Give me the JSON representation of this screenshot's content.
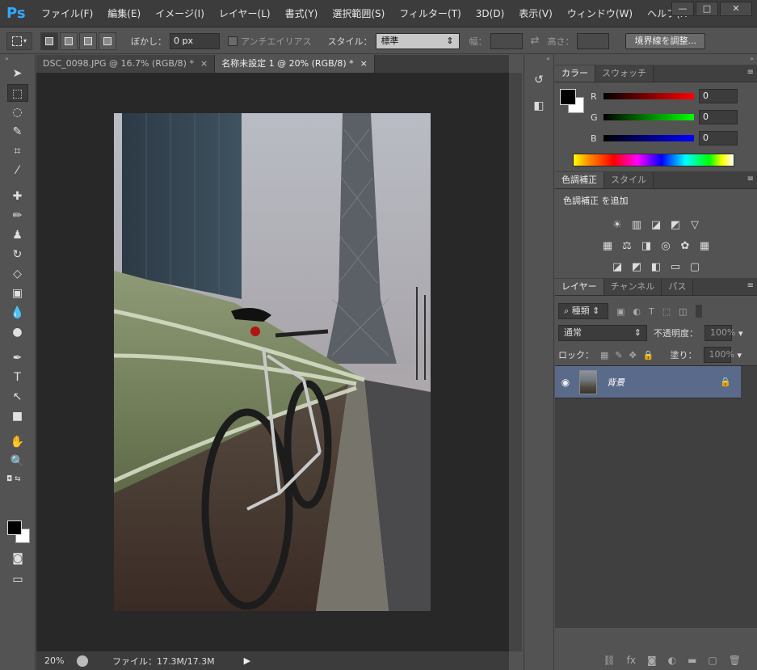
{
  "app": {
    "logo": "Ps",
    "menu": [
      "ファイル(F)",
      "編集(E)",
      "イメージ(I)",
      "レイヤー(L)",
      "書式(Y)",
      "選択範囲(S)",
      "フィルター(T)",
      "3D(D)",
      "表示(V)",
      "ウィンドウ(W)",
      "ヘルプ(H"
    ],
    "window_buttons": {
      "minimize": "—",
      "maximize": "□",
      "close": "✕"
    }
  },
  "options": {
    "feather_label": "ぼかし：",
    "feather_value": "0 px",
    "antialias_label": "アンチエイリアス",
    "style_label": "スタイル：",
    "style_value": "標準",
    "width_label": "幅：",
    "height_label": "高さ：",
    "refine_button": "境界線を調整..."
  },
  "documents": {
    "tabs": [
      {
        "title": "DSC_0098.JPG @ 16.7% (RGB/8) *",
        "close": "×",
        "active": false
      },
      {
        "title": "名称未設定 1 @ 20% (RGB/8) *",
        "close": "×",
        "active": true
      }
    ]
  },
  "status": {
    "zoom": "20%",
    "file_info": "ファイル：17.3M/17.3M"
  },
  "color_panel": {
    "tabs": [
      "カラー",
      "スウォッチ"
    ],
    "channels": [
      {
        "label": "R",
        "value": "0",
        "color": "#ff0000"
      },
      {
        "label": "G",
        "value": "0",
        "color": "#00ff00"
      },
      {
        "label": "B",
        "value": "0",
        "color": "#0000ff"
      }
    ]
  },
  "adjustments_panel": {
    "tabs": [
      "色調補正",
      "スタイル"
    ],
    "heading": "色調補正 を追加"
  },
  "layers_panel": {
    "tabs": [
      "レイヤー",
      "チャンネル",
      "パス"
    ],
    "filter_label": "種類",
    "blend_mode": "通常",
    "opacity_label": "不透明度：",
    "opacity_value": "100%",
    "lock_label": "ロック：",
    "fill_label": "塗り：",
    "fill_value": "100%",
    "layers": [
      {
        "name": "背景",
        "visible": true,
        "locked": true
      }
    ]
  },
  "colors": {
    "accent": "#31a8ff",
    "selected_layer": "#5a6a8a"
  }
}
